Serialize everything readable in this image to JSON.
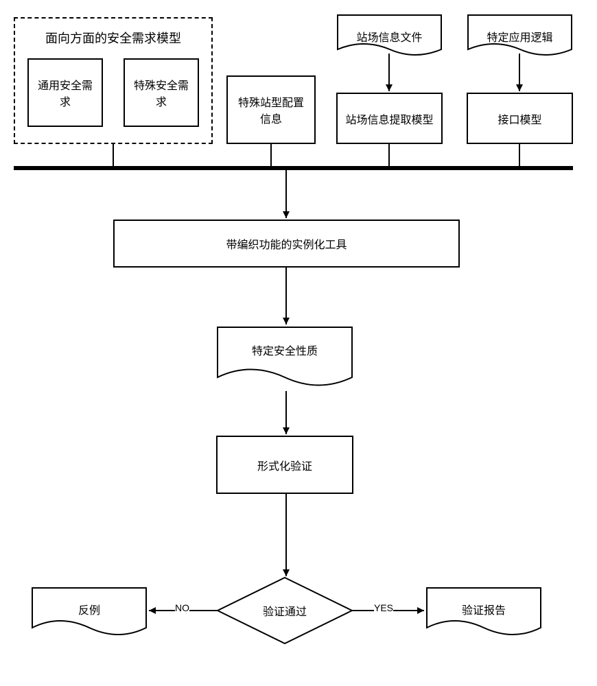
{
  "groupTitle": "面向方面的安全需求模型",
  "generalReq": "通用安全需求",
  "specialReq": "特殊安全需求",
  "specialStationConfig": "特殊站型配置信息",
  "stationInfoFile": "站场信息文件",
  "stationExtractModel": "站场信息提取模型",
  "specificAppLogic": "特定应用逻辑",
  "interfaceModel": "接口模型",
  "instantiationTool": "带编织功能的实例化工具",
  "specificSafetyProperty": "特定安全性质",
  "formalVerification": "形式化验证",
  "verificationPassed": "验证通过",
  "counterexample": "反例",
  "verificationReport": "验证报告",
  "noLabel": "NO",
  "yesLabel": "YES"
}
